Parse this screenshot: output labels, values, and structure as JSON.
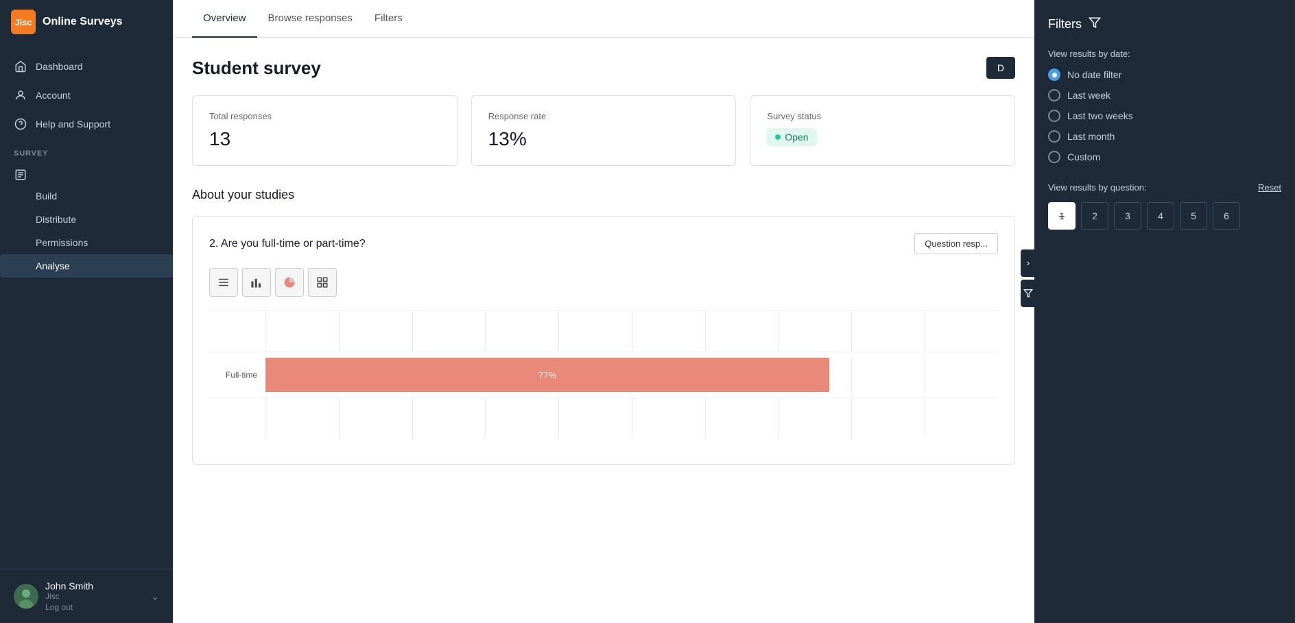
{
  "app": {
    "logo": "Jisc",
    "name": "Online Surveys"
  },
  "sidebar": {
    "nav": [
      {
        "id": "dashboard",
        "label": "Dashboard",
        "icon": "home"
      },
      {
        "id": "account",
        "label": "Account",
        "icon": "person"
      },
      {
        "id": "help",
        "label": "Help and Support",
        "icon": "help"
      }
    ],
    "survey_section": "SURVEY",
    "survey_items": [
      {
        "id": "build",
        "label": "Build"
      },
      {
        "id": "distribute",
        "label": "Distribute"
      },
      {
        "id": "permissions",
        "label": "Permissions"
      },
      {
        "id": "analyse",
        "label": "Analyse",
        "active": true
      }
    ],
    "user": {
      "name": "John Smith",
      "org": "Jisc",
      "logout": "Log out"
    }
  },
  "tabs": [
    {
      "id": "overview",
      "label": "Overview",
      "active": true
    },
    {
      "id": "browse-responses",
      "label": "Browse responses"
    },
    {
      "id": "filters",
      "label": "Filters"
    }
  ],
  "survey": {
    "title": "Student survey",
    "download_label": "D"
  },
  "stats": [
    {
      "id": "total-responses",
      "label": "Total responses",
      "value": "13"
    },
    {
      "id": "response-rate",
      "label": "Response rate",
      "value": "13%"
    },
    {
      "id": "survey-status",
      "label": "Survey status",
      "value": "Open"
    }
  ],
  "section": {
    "title": "About your studies"
  },
  "question": {
    "text": "2. Are you full-time or part-time?",
    "responses_label": "Question resp...",
    "chart_types": [
      {
        "id": "table",
        "icon": "☰",
        "active": false
      },
      {
        "id": "bar",
        "icon": "📊",
        "active": false
      },
      {
        "id": "pie",
        "icon": "◑",
        "active": false
      },
      {
        "id": "grid",
        "icon": "⊞",
        "active": false
      }
    ],
    "bars": [
      {
        "label": "Full-time",
        "value": 77,
        "display": "77%",
        "color": "#e8897a"
      }
    ]
  },
  "filters": {
    "title": "Filters",
    "date_section_label": "View results by date:",
    "date_options": [
      {
        "id": "no-date",
        "label": "No date filter",
        "selected": true
      },
      {
        "id": "last-week",
        "label": "Last week",
        "selected": false
      },
      {
        "id": "last-two-weeks",
        "label": "Last two weeks",
        "selected": false
      },
      {
        "id": "last-month",
        "label": "Last month",
        "selected": false
      },
      {
        "id": "custom",
        "label": "Custom",
        "selected": false
      }
    ],
    "question_section_label": "View results by question:",
    "reset_label": "Reset",
    "question_numbers": [
      {
        "num": "1",
        "active": true
      },
      {
        "num": "2",
        "active": false
      },
      {
        "num": "3",
        "active": false
      },
      {
        "num": "4",
        "active": false
      },
      {
        "num": "5",
        "active": false
      },
      {
        "num": "6",
        "active": false
      }
    ]
  }
}
